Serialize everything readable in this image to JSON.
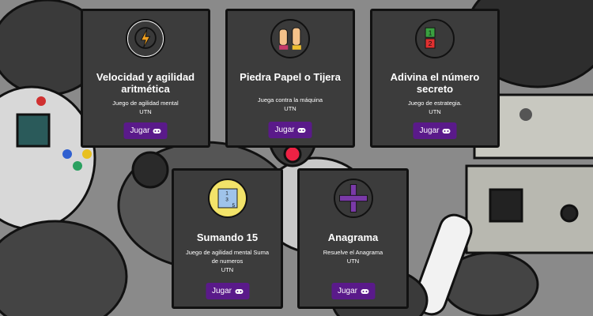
{
  "games": [
    {
      "title": "Velocidad y agilidad aritmética",
      "description": "Juego de agilidad mental",
      "org": "UTN",
      "button": "Jugar",
      "icon": "brain-lightning-icon"
    },
    {
      "title": "Piedra Papel o Tijera",
      "description": "Juega contra la máquina",
      "org": "UTN",
      "button": "Jugar",
      "icon": "hands-icon"
    },
    {
      "title": "Adivina el número secreto",
      "description": "Juego de estrategia.",
      "org": "UTN",
      "button": "Jugar",
      "icon": "numbers-blocks-icon"
    },
    {
      "title": "Sumando 15",
      "description": "Juego de agilidad mental Suma de numeros",
      "org": "UTN",
      "button": "Jugar",
      "icon": "number-grid-icon"
    },
    {
      "title": "Anagrama",
      "description": "Resuelve el Anagrama",
      "org": "UTN",
      "button": "Jugar",
      "icon": "letter-tiles-icon"
    }
  ]
}
